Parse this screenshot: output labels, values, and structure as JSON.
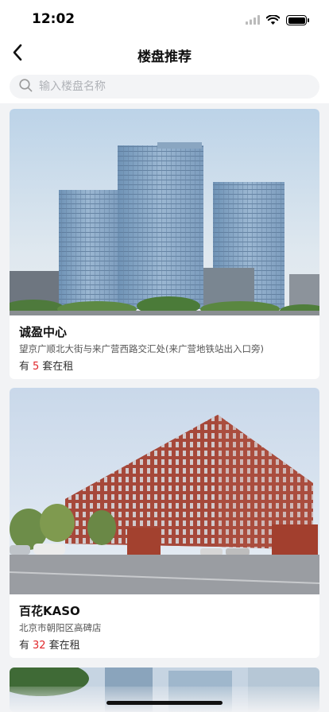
{
  "status": {
    "time": "12:02"
  },
  "nav": {
    "title": "楼盘推荐"
  },
  "search": {
    "placeholder": "输入楼盘名称"
  },
  "buildings": [
    {
      "name": "诚盈中心",
      "address": "望京广顺北大街与来广营西路交汇处(来广营地铁站出入口旁)",
      "rent_prefix": "有",
      "rent_count": "5",
      "rent_suffix": "套在租"
    },
    {
      "name": "百花KASO",
      "address": "北京市朝阳区高碑店",
      "rent_prefix": "有",
      "rent_count": "32",
      "rent_suffix": "套在租"
    }
  ],
  "colors": {
    "accent": "#e0262a",
    "background": "#f2f3f5"
  }
}
